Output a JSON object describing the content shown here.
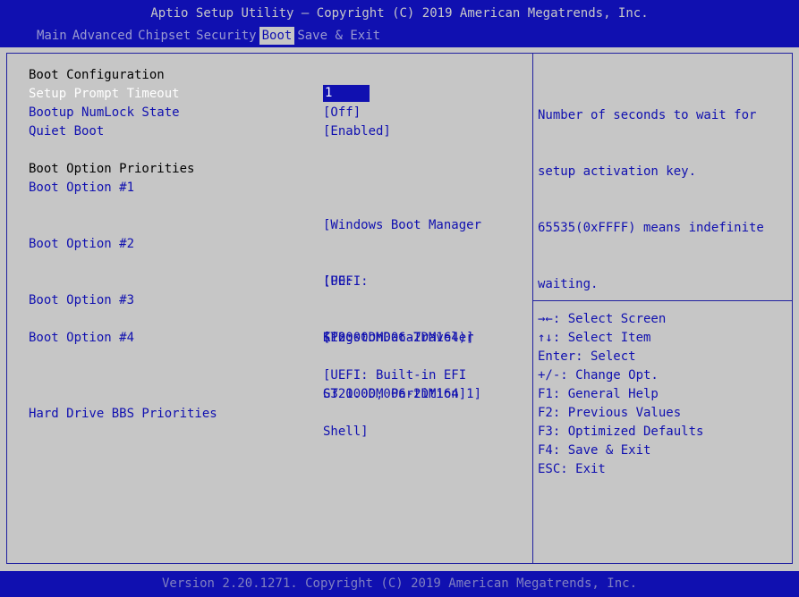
{
  "header": {
    "title": "Aptio Setup Utility – Copyright (C) 2019 American Megatrends, Inc.",
    "tabs": [
      "Main",
      "Advanced",
      "Chipset",
      "Security",
      "Boot",
      "Save & Exit"
    ],
    "active_tab": "Boot"
  },
  "main": {
    "boot_config_heading": "Boot Configuration",
    "setup_prompt_timeout": {
      "label": "Setup Prompt Timeout",
      "value": "1"
    },
    "bootup_numlock": {
      "label": "Bootup NumLock State",
      "value": "[Off]"
    },
    "quiet_boot": {
      "label": "Quiet Boot",
      "value": "[Enabled]"
    },
    "boot_priorities_heading": "Boot Option Priorities",
    "boot_options": [
      {
        "label": "Boot Option #1",
        "value_lines": [
          "[Windows Boot Manager",
          "(P0:",
          "ST2000DM006-2DM164)]"
        ]
      },
      {
        "label": "Boot Option #2",
        "value_lines": [
          "[UEFI:",
          "KingstonDataTraveler",
          "G3 1.00, Partition 1]"
        ]
      },
      {
        "label": "Boot Option #3",
        "value_lines": [
          "[P0:",
          "ST2000DM006-2DM164]"
        ]
      },
      {
        "label": "Boot Option #4",
        "value_lines": [
          "[UEFI: Built-in EFI",
          "Shell]"
        ]
      }
    ],
    "hdd_bbs": {
      "label": "Hard Drive BBS Priorities"
    }
  },
  "help": {
    "lines": [
      "Number of seconds to wait for",
      "setup activation key.",
      "65535(0xFFFF) means indefinite",
      "waiting."
    ]
  },
  "keys": [
    "→←: Select Screen",
    "↑↓: Select Item",
    "Enter: Select",
    "+/-: Change Opt.",
    "F1: General Help",
    "F2: Previous Values",
    "F3: Optimized Defaults",
    "F4: Save & Exit",
    "ESC: Exit"
  ],
  "footer": {
    "text": "Version 2.20.1271. Copyright (C) 2019 American Megatrends, Inc."
  }
}
